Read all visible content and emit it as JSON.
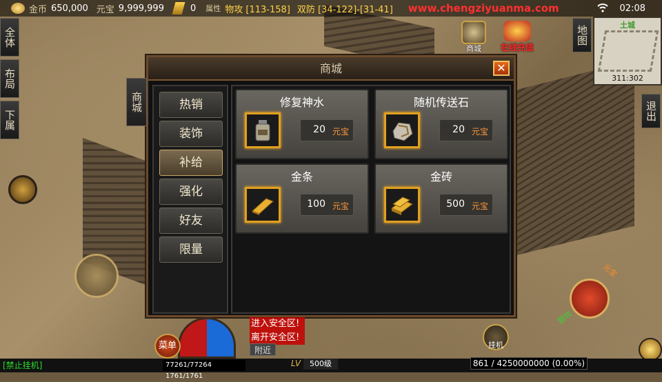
{
  "topbar": {
    "gold_label": "金币",
    "gold_value": "650,000",
    "yuanbao_label": "元宝",
    "yuanbao_value": "9,999,999",
    "badge_value": "0",
    "attr_label": "属性",
    "phys_atk": "物攻 [113-158]",
    "dual_def": "双防 [34-122]-[31-41]",
    "website": "www.chengziyuanma.com",
    "time": "02:08"
  },
  "left_buttons": [
    "全体",
    "布局",
    "下属"
  ],
  "right_buttons": {
    "map": "地图",
    "exit": "退出"
  },
  "minimap": {
    "title": "土城",
    "coords": "311:302"
  },
  "shop_icon_label": "商城",
  "recharge_label": "在线充值",
  "dialog": {
    "title": "商城",
    "close_symbol": "✕",
    "side_tab": "商城",
    "categories": [
      "热销",
      "装饰",
      "补给",
      "强化",
      "好友",
      "限量"
    ],
    "active_category": "补给",
    "currency": "元宝",
    "items": [
      {
        "name": "修复神水",
        "price": "20",
        "icon": "potion-icon"
      },
      {
        "name": "随机传送石",
        "price": "20",
        "icon": "stone-icon"
      },
      {
        "name": "金条",
        "price": "100",
        "icon": "gold-bar-icon"
      },
      {
        "name": "金砖",
        "price": "500",
        "icon": "gold-brick-icon"
      }
    ]
  },
  "bottom": {
    "forbid_hang": "[禁止挂机]",
    "menu": "菜单",
    "safe_enter": "进入安全区!",
    "safe_leave": "离开安全区!",
    "nearby": "附近",
    "hp_mp": "77261/77264  1761/1761",
    "lv_label": "LV",
    "level": "500级",
    "exp": "861 / 4250000000 (0.00%)",
    "hang": "挂机",
    "skill_a": "元宝",
    "skill_b": "群攻"
  },
  "colors": {
    "accent_gold": "#e0a020",
    "site_red": "#ff3030",
    "dialog_border": "#6b4a2a"
  }
}
